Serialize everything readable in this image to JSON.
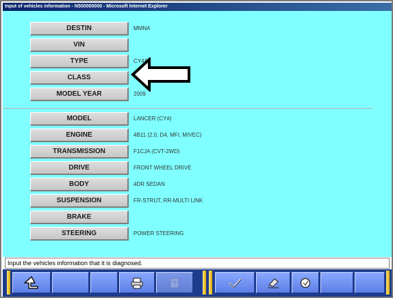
{
  "window": {
    "title": "Input of vehicles information - N500000000 - Microsoft Internet Explorer"
  },
  "fields": [
    {
      "label": "DESTIN",
      "value": "MMNA"
    },
    {
      "label": "VIN",
      "value": ""
    },
    {
      "label": "TYPE",
      "value": "CY4A"
    },
    {
      "label": "CLASS",
      "value": ""
    },
    {
      "label": "MODEL YEAR",
      "value": "2009"
    },
    {
      "label": "MODEL",
      "value": "LANCER (CY#)"
    },
    {
      "label": "ENGINE",
      "value": "4B11 (2.0, D4, MFI, MIVEC)"
    },
    {
      "label": "TRANSMISSION",
      "value": "F1CJA (CVT-2WD)"
    },
    {
      "label": "DRIVE",
      "value": "FRONT WHEEL DRIVE"
    },
    {
      "label": "BODY",
      "value": "4DR SEDAN"
    },
    {
      "label": "SUSPENSION",
      "value": "FR-STRUT, RR-MULTI LINK"
    },
    {
      "label": "BRAKE",
      "value": ""
    },
    {
      "label": "STEERING",
      "value": "POWER STEERING"
    }
  ],
  "status": {
    "message": "Input the vehicles information that it is diagnosed."
  },
  "toolbar": {
    "buttons": [
      {
        "icon": "back-arrow-icon",
        "enabled": true
      },
      {
        "icon": "",
        "enabled": true
      },
      {
        "icon": "",
        "enabled": true
      },
      {
        "icon": "print-icon",
        "enabled": true
      },
      {
        "icon": "help-icon",
        "enabled": false
      },
      {
        "icon": "checkmark-icon",
        "enabled": true
      },
      {
        "icon": "eraser-icon",
        "enabled": true
      },
      {
        "icon": "search-icon",
        "enabled": true
      }
    ]
  },
  "colors": {
    "content_bg": "#7fffff",
    "toolbar_bg": "#1d3c8c",
    "button_blue": "#6f8ef0",
    "gold_divider": "#f2c400"
  }
}
